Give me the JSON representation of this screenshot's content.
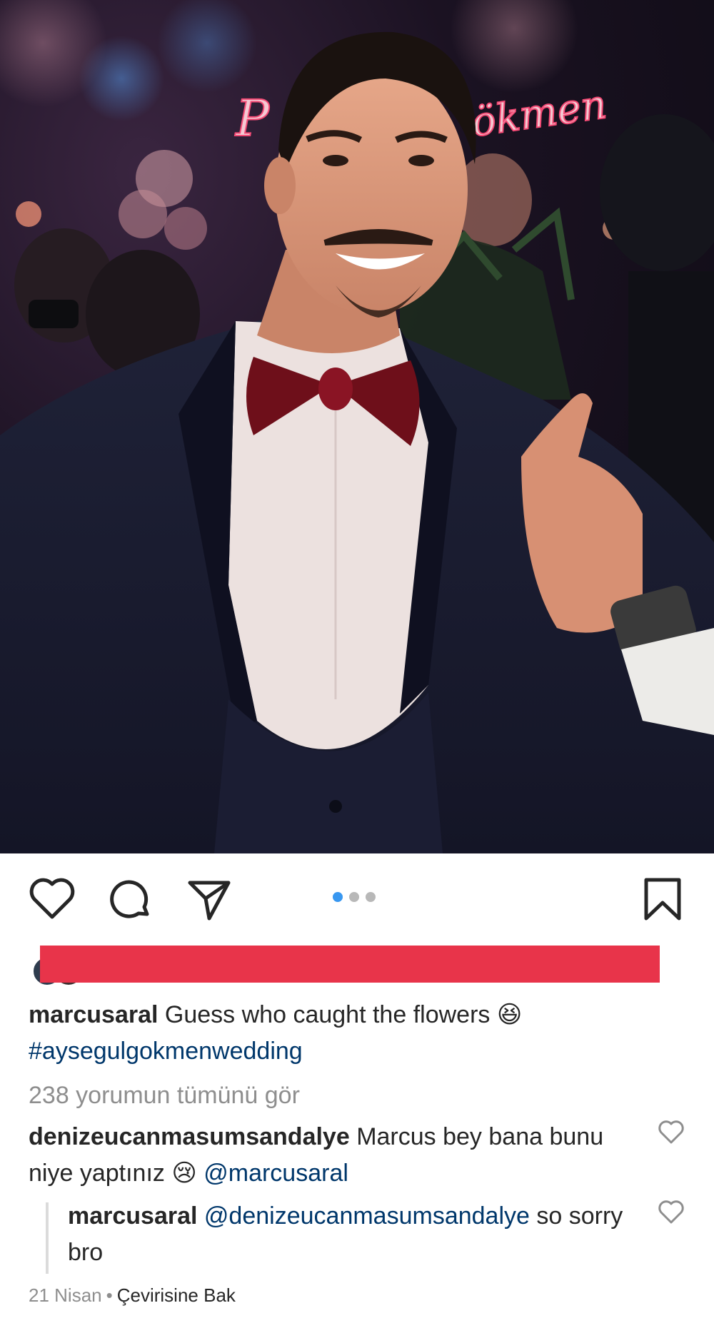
{
  "post": {
    "photo_icon": "party-photo-man-in-tuxedo",
    "sign_text": "ökmen",
    "carousel": {
      "count": 3,
      "active_index": 0
    }
  },
  "actions": {
    "like_icon": "heart-icon",
    "comment_icon": "comment-bubble-icon",
    "share_icon": "paper-plane-icon",
    "save_icon": "bookmark-icon"
  },
  "caption": {
    "username": "marcusaral",
    "text": "Guess who caught the flowers 😆",
    "hashtag": "#aysegulgokmenwedding"
  },
  "comments": {
    "view_all_label": "238 yorumun tümünü gör",
    "items": [
      {
        "username": "denizeucanmasumsandalye",
        "text": "Marcus bey bana bunu niye yaptınız 😢",
        "mention": "@marcusaral"
      }
    ],
    "reply": {
      "username": "marcusaral",
      "mention": "@denizeucanmasumsandalye",
      "text": "so sorry bro"
    }
  },
  "meta": {
    "date": "21 Nisan",
    "separator": "•",
    "translate_label": "Çevirisine Bak"
  },
  "colors": {
    "accent_blue": "#3897f0",
    "link": "#00376b",
    "redaction": "#e8344a",
    "muted": "#8e8e8e"
  }
}
